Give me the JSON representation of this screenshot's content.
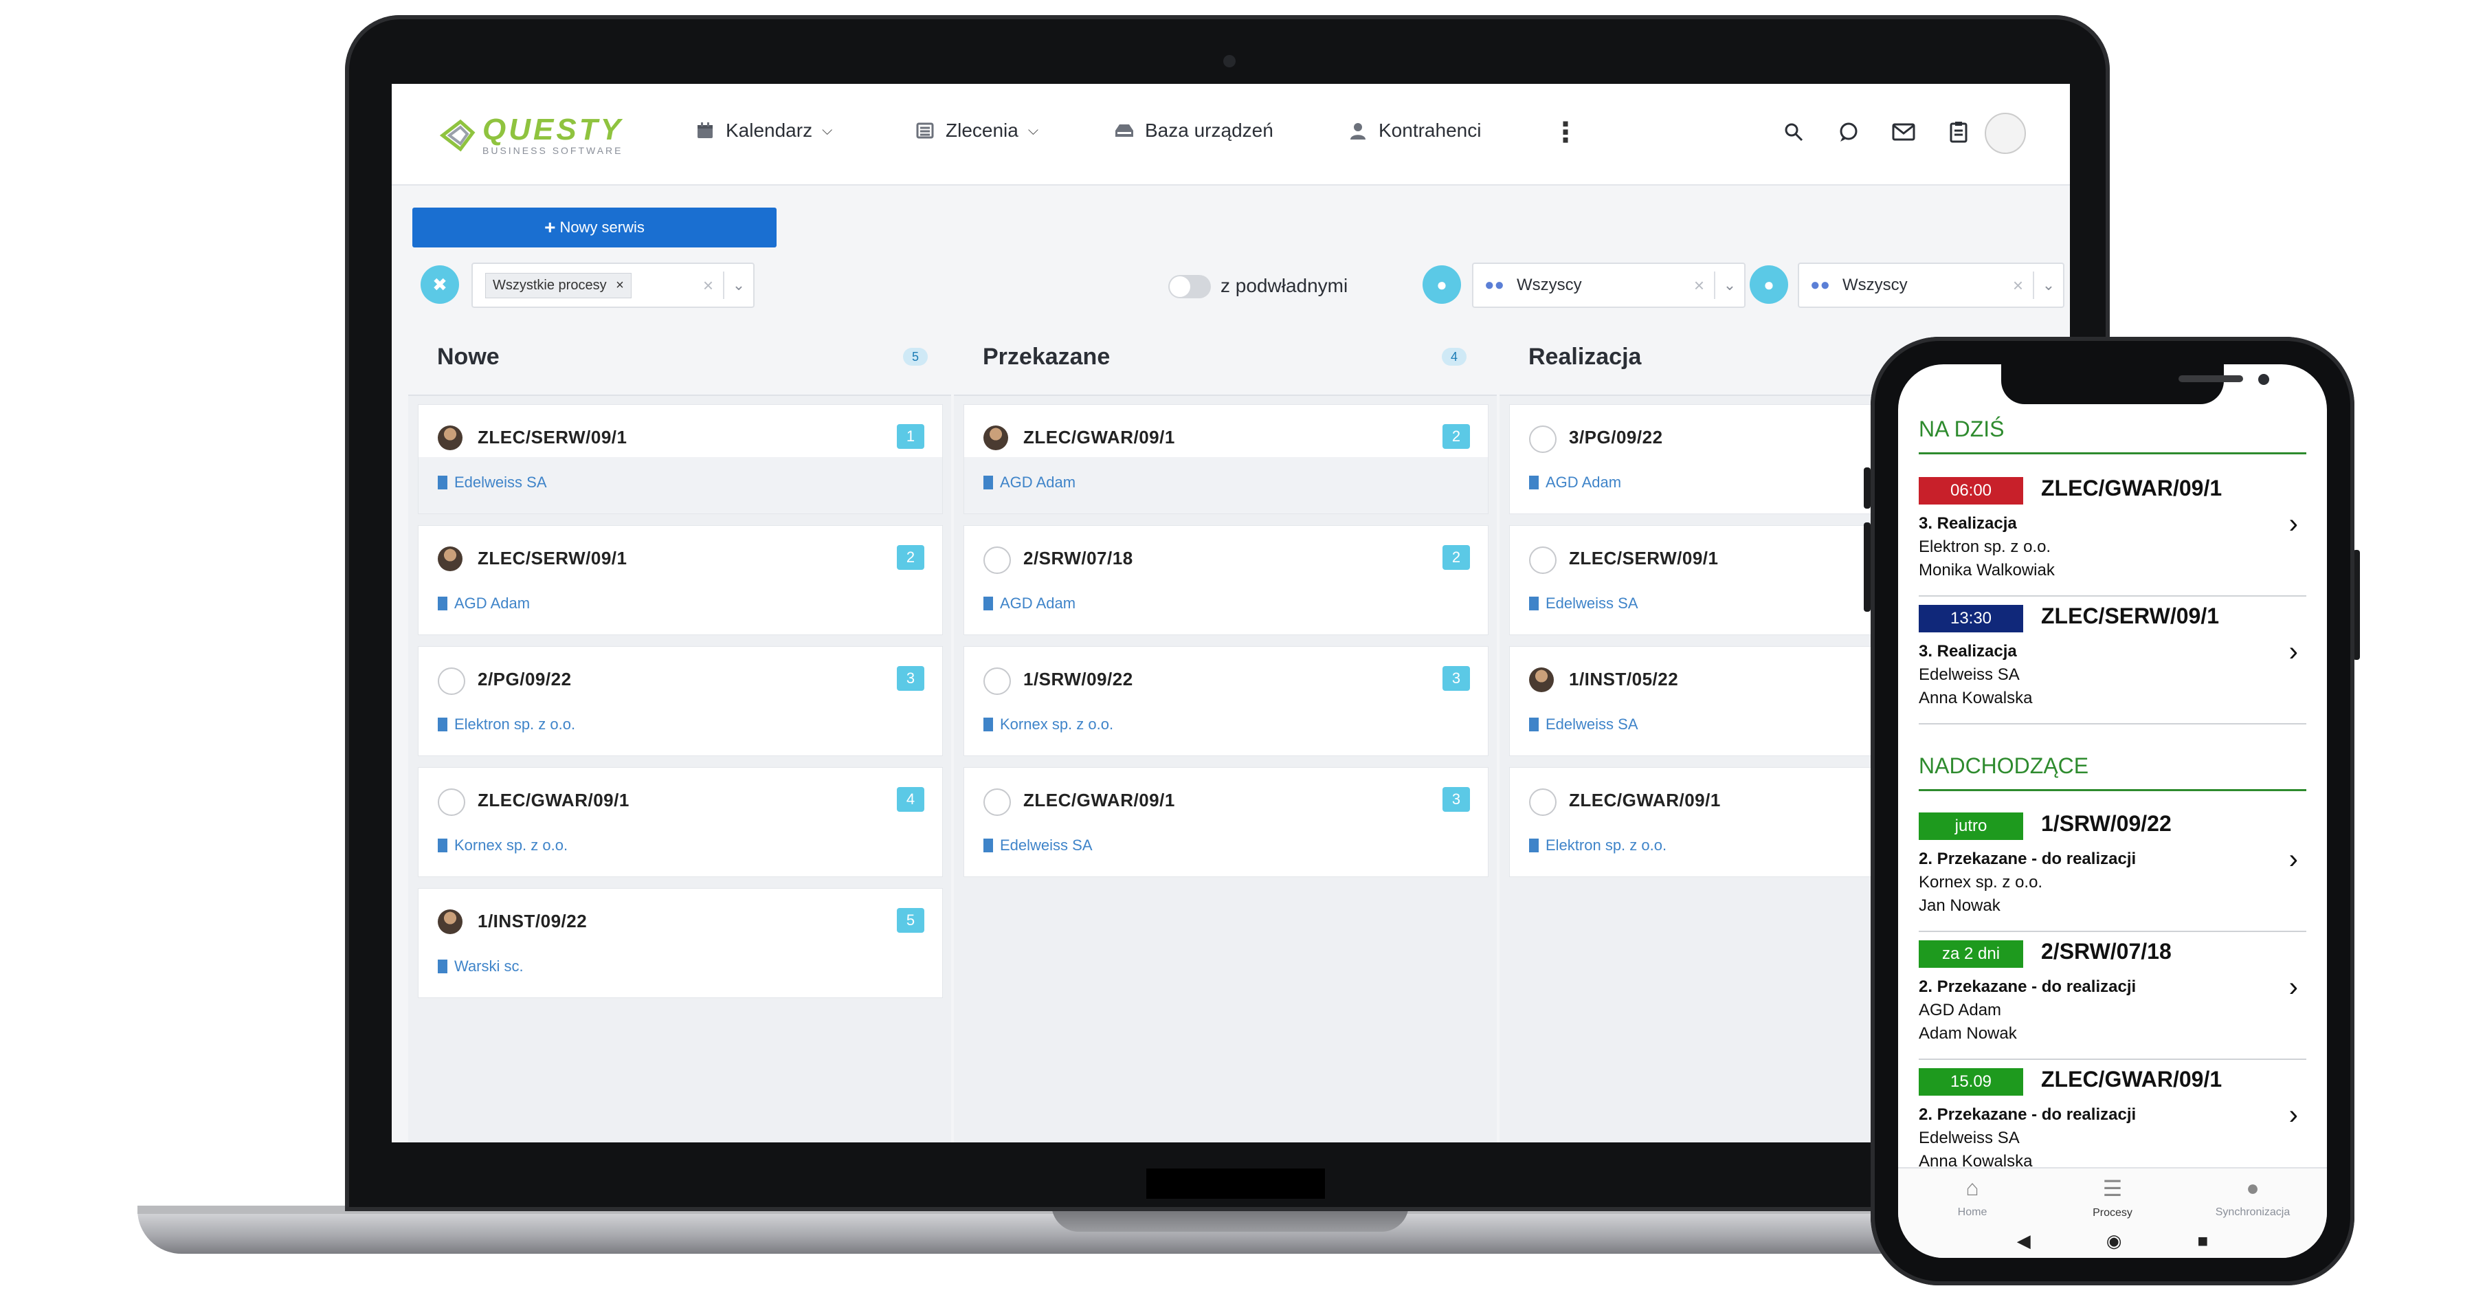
{
  "app": {
    "logo_name": "QUESTY",
    "logo_sub": "BUSINESS SOFTWARE",
    "brand_color": "#8fc33f"
  },
  "nav": {
    "items": [
      {
        "label": "Kalendarz",
        "icon": "calendar-icon"
      },
      {
        "label": "Zlecenia",
        "icon": "list-icon"
      },
      {
        "label": "Baza urządzeń",
        "icon": "device-icon"
      },
      {
        "label": "Kontrahenci",
        "icon": "person-icon"
      }
    ],
    "right_icons": [
      "search-icon",
      "chat-icon",
      "mail-icon",
      "clipboard-icon",
      "avatar"
    ]
  },
  "toolbar": {
    "new_button": "Nowy serwis",
    "process_filter_chip": "Wszystkie procesy",
    "toggle_label": "z podwładnymi",
    "select1_value": "Wszyscy",
    "select2_value": "Wszyscy"
  },
  "columns": [
    {
      "title": "Nowe",
      "count": "5",
      "cards": [
        {
          "title": "ZLEC/SERW/09/1",
          "num": "1",
          "client": "Edelweiss SA",
          "avatar": "photo"
        },
        {
          "title": "ZLEC/SERW/09/1",
          "num": "2",
          "client": "AGD Adam",
          "avatar": "photo"
        },
        {
          "title": "2/PG/09/22",
          "num": "3",
          "client": "Elektron sp. z o.o.",
          "avatar": "drawing"
        },
        {
          "title": "ZLEC/GWAR/09/1",
          "num": "4",
          "client": "Kornex sp. z o.o.",
          "avatar": "drawing"
        },
        {
          "title": "1/INST/09/22",
          "num": "5",
          "client": "Warski sc.",
          "avatar": "photo"
        }
      ]
    },
    {
      "title": "Przekazane",
      "count": "4",
      "cards": [
        {
          "title": "ZLEC/GWAR/09/1",
          "num": "2",
          "client": "AGD Adam",
          "avatar": "photo"
        },
        {
          "title": "2/SRW/07/18",
          "num": "2",
          "client": "AGD Adam",
          "avatar": "drawing"
        },
        {
          "title": "1/SRW/09/22",
          "num": "3",
          "client": "Kornex sp. z o.o.",
          "avatar": "drawing"
        },
        {
          "title": "ZLEC/GWAR/09/1",
          "num": "3",
          "client": "Edelweiss SA",
          "avatar": "drawing"
        }
      ]
    },
    {
      "title": "Realizacja",
      "count": "",
      "cards": [
        {
          "title": "3/PG/09/22",
          "num": "",
          "client": "AGD Adam",
          "avatar": "drawing"
        },
        {
          "title": "ZLEC/SERW/09/1",
          "num": "",
          "client": "Edelweiss SA",
          "avatar": "drawing"
        },
        {
          "title": "1/INST/05/22",
          "num": "",
          "client": "Edelweiss SA",
          "avatar": "photo"
        },
        {
          "title": "ZLEC/GWAR/09/1",
          "num": "",
          "client": "Elektron sp. z o.o.",
          "avatar": "drawing"
        }
      ]
    }
  ],
  "phone": {
    "today_title": "NA DZIŚ",
    "upcoming_title": "NADCHODZĄCE",
    "today": [
      {
        "badge": "06:00",
        "badge_color": "#c8202a",
        "number": "ZLEC/GWAR/09/1",
        "status": "3. Realizacja",
        "client": "Elektron sp. z o.o.",
        "person": "Monika Walkowiak"
      },
      {
        "badge": "13:30",
        "badge_color": "#10287a",
        "number": "ZLEC/SERW/09/1",
        "status": "3. Realizacja",
        "client": "Edelweiss SA",
        "person": "Anna Kowalska"
      }
    ],
    "upcoming": [
      {
        "badge": "jutro",
        "badge_color": "#1e9a1e",
        "number": "1/SRW/09/22",
        "status": "2. Przekazane - do realizacji",
        "client": "Kornex sp. z o.o.",
        "person": "Jan Nowak"
      },
      {
        "badge": "za 2 dni",
        "badge_color": "#1e9a1e",
        "number": "2/SRW/07/18",
        "status": "2. Przekazane - do realizacji",
        "client": "AGD Adam",
        "person": "Adam Nowak"
      },
      {
        "badge": "15.09",
        "badge_color": "#1e9a1e",
        "number": "ZLEC/GWAR/09/1",
        "status": "2. Przekazane - do realizacji",
        "client": "Edelweiss SA",
        "person": "Anna Kowalska"
      }
    ],
    "tabs": [
      {
        "label": "Home",
        "icon": "home-icon"
      },
      {
        "label": "Procesy",
        "icon": "list-icon"
      },
      {
        "label": "Synchronizacja",
        "icon": "person-icon"
      }
    ]
  }
}
